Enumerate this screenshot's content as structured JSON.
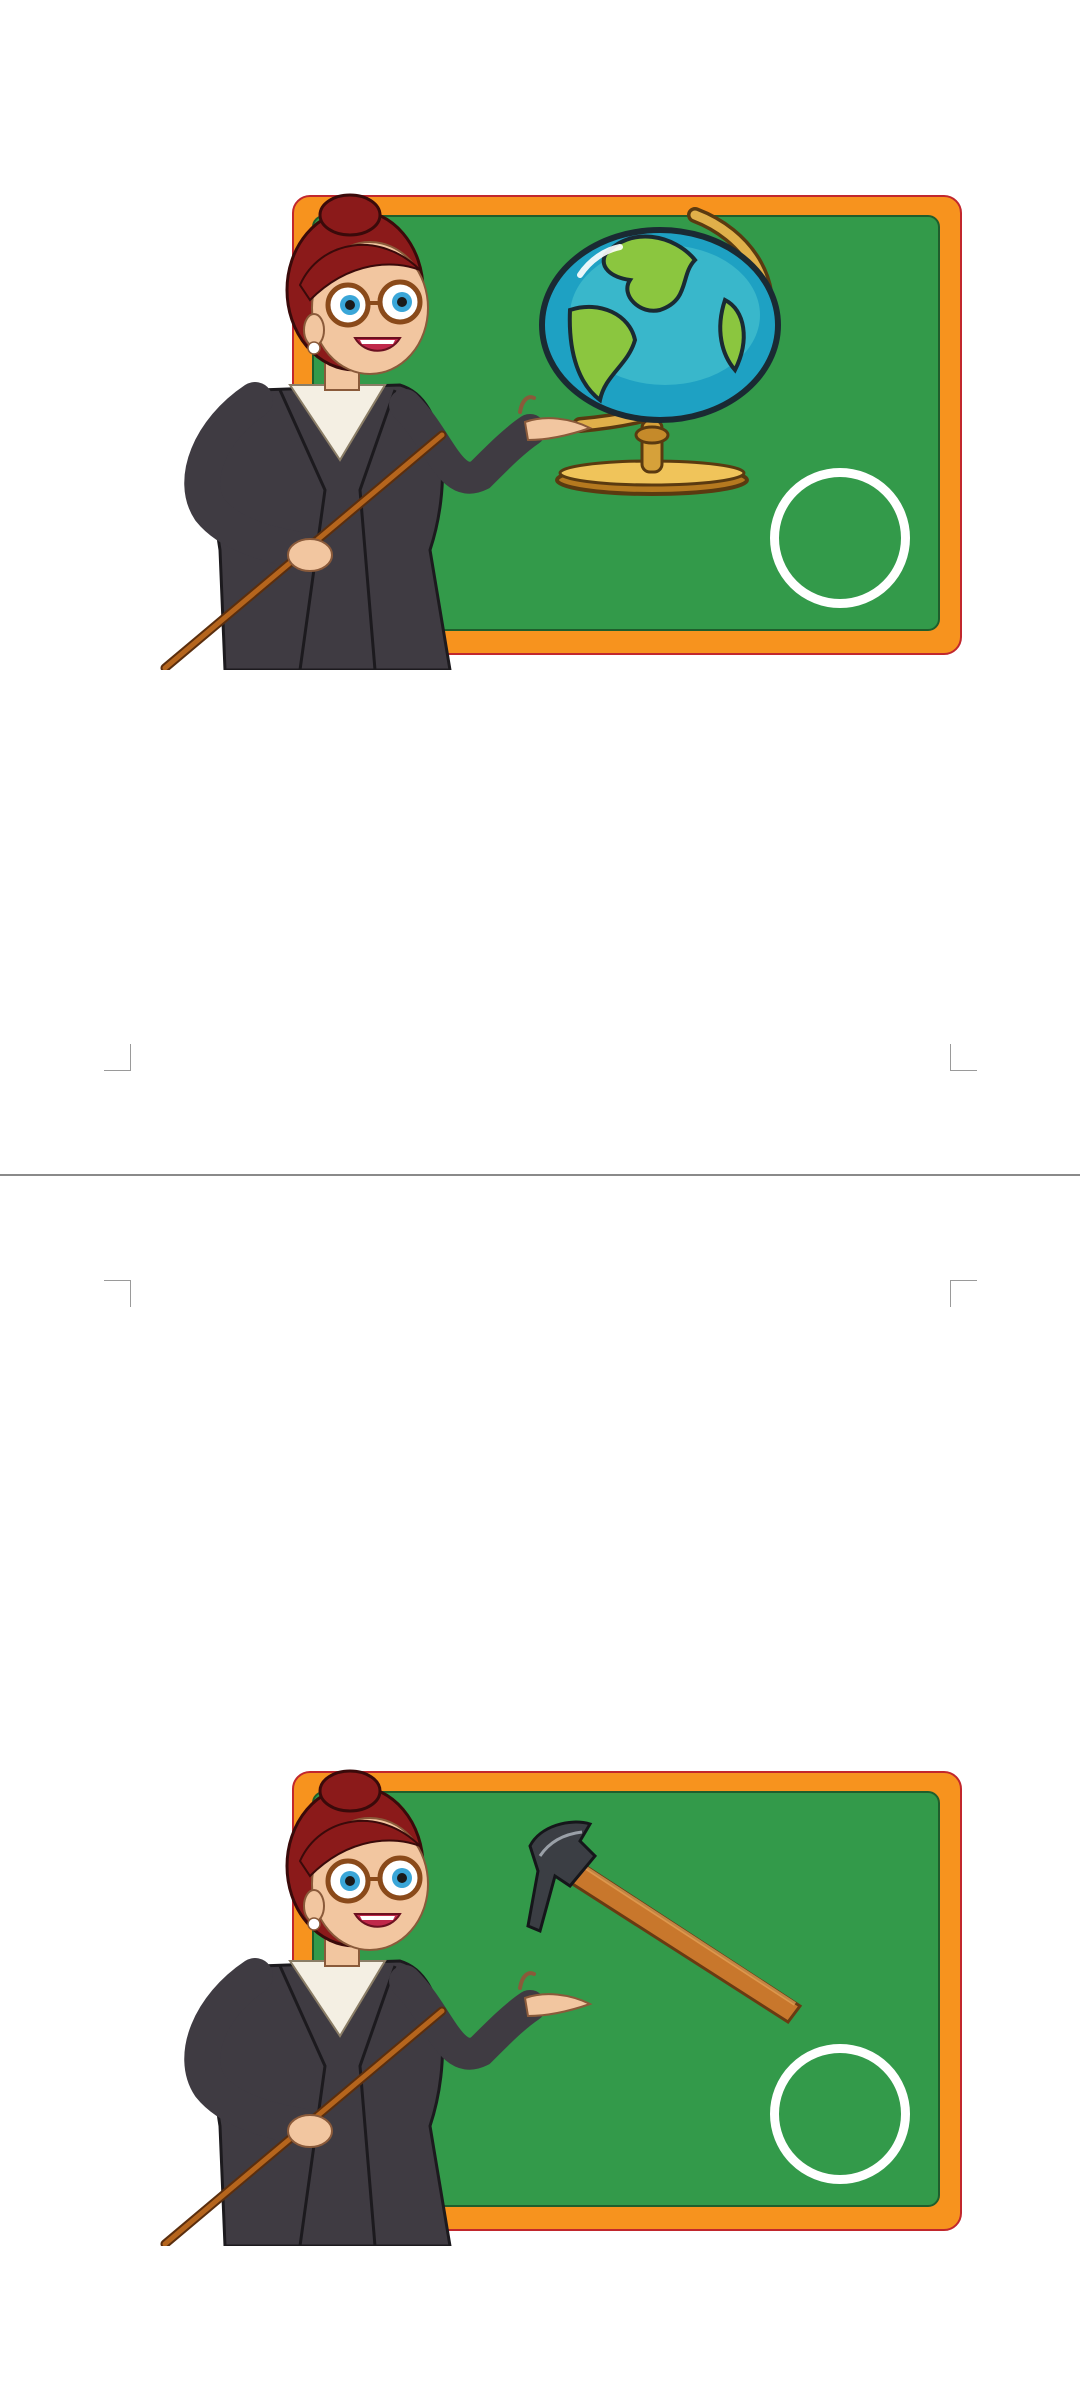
{
  "document": {
    "cards": [
      {
        "object": "globe-icon"
      },
      {
        "object": "hammer-icon"
      }
    ],
    "colors": {
      "board_green": "#339a4a",
      "frame_orange": "#f7931e",
      "frame_outline": "#c1272d",
      "circle_white": "#ffffff"
    }
  }
}
